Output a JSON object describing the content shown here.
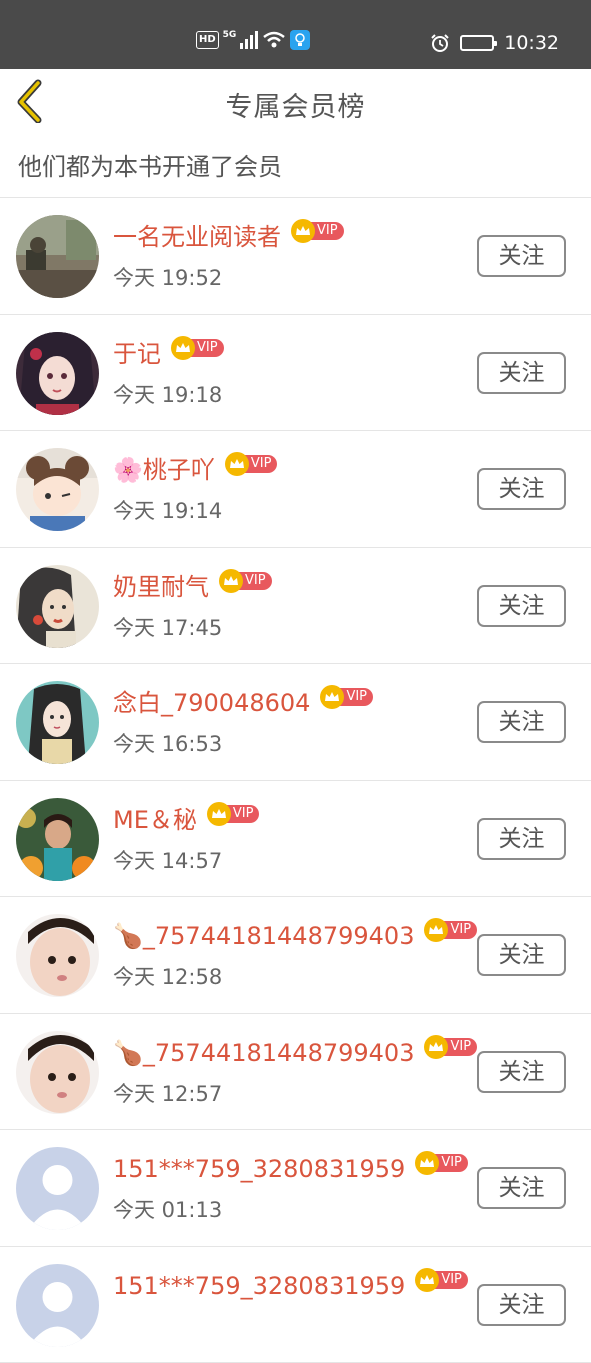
{
  "status_bar": {
    "hd": "HD",
    "network": "5G",
    "time": "10:32"
  },
  "header": {
    "title": "专属会员榜"
  },
  "subtitle": "他们都为本书开通了会员",
  "vip_label": "VIP",
  "follow_label": "关注",
  "members": [
    {
      "name": "一名无业阅读者",
      "time": "今天 19:52",
      "avatar": "photo-street"
    },
    {
      "name": "于记",
      "time": "今天 19:18",
      "avatar": "illustrated-girl"
    },
    {
      "name": "🌸桃子吖",
      "time": "今天 19:14",
      "avatar": "cartoon-girl"
    },
    {
      "name": "奶里耐气",
      "time": "今天 17:45",
      "avatar": "painted-woman"
    },
    {
      "name": "念白_790048604",
      "time": "今天 16:53",
      "avatar": "illustrated-girl-teal"
    },
    {
      "name": "ME＆秘",
      "time": "今天 14:57",
      "avatar": "photo-child-flowers"
    },
    {
      "name": "🍗_75744181448799403",
      "time": "今天 12:58",
      "avatar": "photo-baby"
    },
    {
      "name": "🍗_75744181448799403",
      "time": "今天 12:57",
      "avatar": "photo-baby"
    },
    {
      "name": "151***759_3280831959",
      "time": "今天 01:13",
      "avatar": "default-avatar"
    },
    {
      "name": "151***759_3280831959",
      "time": "",
      "avatar": "default-avatar"
    }
  ],
  "colors": {
    "name": "#d9553d",
    "vip_badge": "#e8585d",
    "crown": "#f5b800",
    "back_arrow": "#e6c200"
  }
}
